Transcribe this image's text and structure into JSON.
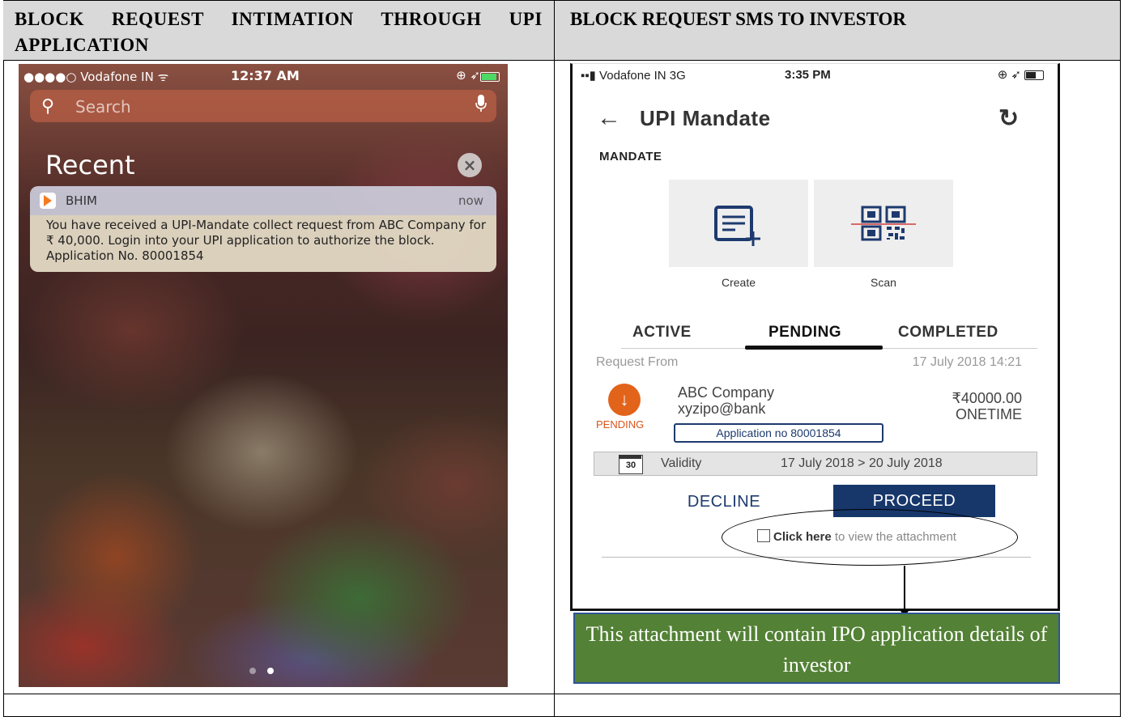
{
  "table": {
    "headers": [
      "BLOCK REQUEST INTIMATION THROUGH UPI APPLICATION",
      "BLOCK REQUEST SMS TO INVESTOR"
    ]
  },
  "notification_screen": {
    "status_bar": {
      "carrier": "●●●●○ Vodafone IN ᯤ",
      "time": "12:37 AM",
      "right_icons": "⊕ ➶"
    },
    "search": {
      "placeholder": "Search",
      "icon": "search-icon",
      "mic_icon": "mic-icon"
    },
    "section_title": "Recent",
    "clear_icon": "close-icon",
    "notification": {
      "app_name": "BHIM",
      "time": "now",
      "message": "You have received a UPI-Mandate collect request from ABC Company for ₹ 40,000. Login into your UPI application to authorize the block. Application No. 80001854"
    },
    "page_dots": 2,
    "active_dot": 1
  },
  "upi_screen": {
    "status_bar": {
      "carrier": "▪▪▮ Vodafone IN  3G",
      "time": "3:35 PM",
      "right_icons": "⊕ ➶"
    },
    "title": "UPI Mandate",
    "section_label": "MANDATE",
    "tiles": [
      {
        "label": "Create",
        "icon": "create-mandate-icon"
      },
      {
        "label": "Scan",
        "icon": "qr-scan-icon"
      }
    ],
    "tabs": [
      "ACTIVE",
      "PENDING",
      "COMPLETED"
    ],
    "selected_tab": "PENDING",
    "request": {
      "from_label": "Request From",
      "datetime": "17 July 2018 14:21",
      "status": "PENDING",
      "payee": "ABC Company",
      "vpa": "xyzipo@bank",
      "amount": "₹40000.00",
      "frequency": "ONETIME",
      "application_no": "Application no 80001854",
      "calendar_day": "30",
      "validity_label": "Validity",
      "validity_range": "17 July 2018 > 20 July 2018"
    },
    "actions": {
      "decline": "DECLINE",
      "proceed": "PROCEED"
    },
    "attachment": {
      "link": "Click here",
      "rest": " to view the attachment"
    }
  },
  "callout": "This attachment will contain IPO application details of investor",
  "colors": {
    "header_bg": "#d9d9d9",
    "proceed_bg": "#17376b",
    "pending_orange": "#e2631a",
    "callout_bg": "#538135",
    "callout_border": "#2f5597"
  }
}
